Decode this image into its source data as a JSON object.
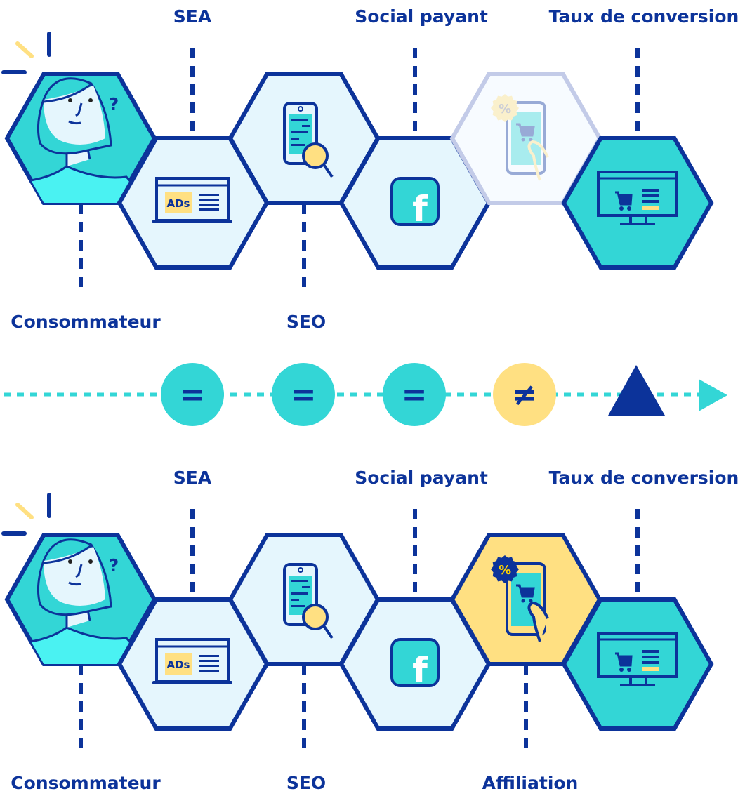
{
  "colors": {
    "navy": "#0c339a",
    "teal": "#33d6d6",
    "light": "#e5f6fd",
    "yellow": "#ffe082",
    "cyan": "#4af2f2",
    "faded_stroke": "#c3cbe8",
    "faded_fill": "#f7fbff"
  },
  "rows": [
    {
      "id": "top",
      "labels": {
        "consumer": "Consommateur",
        "sea": "SEA",
        "seo": "SEO",
        "social": "Social payant",
        "conversion": "Taux de conversion"
      },
      "affiliation_active": false
    },
    {
      "id": "bottom",
      "labels": {
        "consumer": "Consommateur",
        "sea": "SEA",
        "seo": "SEO",
        "social": "Social payant",
        "conversion": "Taux de conversion",
        "affiliation": "Affiliation"
      },
      "affiliation_active": true
    }
  ],
  "ads_text": "ADs",
  "facebook_letter": "f",
  "badge_text": "%",
  "comparison": {
    "symbols": [
      "=",
      "=",
      "=",
      "≠"
    ],
    "symbol_colors": [
      "#33d6d6",
      "#33d6d6",
      "#33d6d6",
      "#ffe082"
    ],
    "result_icon": "triangle-up-icon",
    "arrow_icon": "arrow-right-icon"
  }
}
